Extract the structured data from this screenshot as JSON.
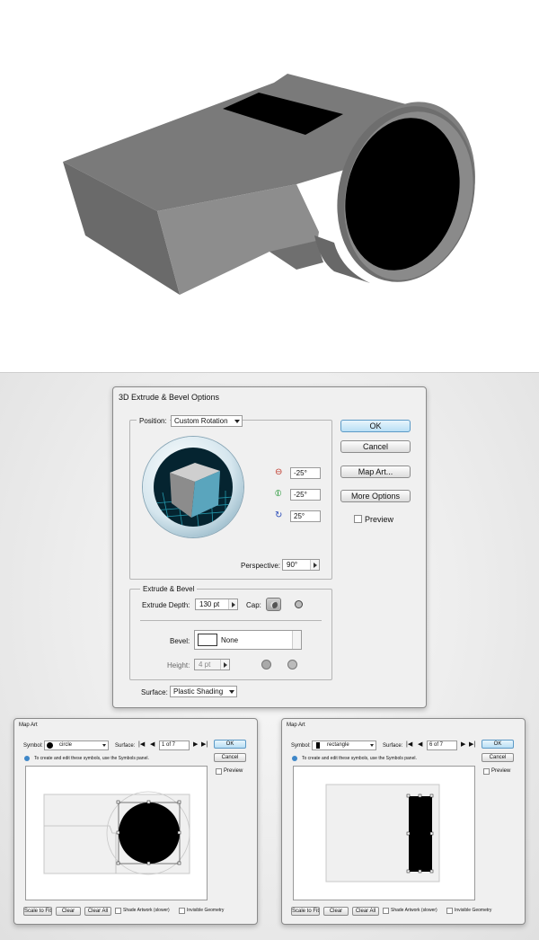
{
  "colors": {
    "whistle_dark": "#5c5c5c",
    "whistle_mid": "#7d7d7d",
    "whistle_light": "#999999",
    "cube_front": "#5aa5bd",
    "ok_accent": "#b9dff5"
  },
  "extrude_dialog": {
    "title": "3D Extrude & Bevel Options",
    "position_label": "Position:",
    "position_value": "Custom Rotation",
    "rotation_x": "-25°",
    "rotation_y": "-25°",
    "rotation_z": "25°",
    "perspective_label": "Perspective:",
    "perspective_value": "90°",
    "ok_label": "OK",
    "cancel_label": "Cancel",
    "map_art_label": "Map Art...",
    "more_options_label": "More Options",
    "preview_label": "Preview",
    "extrude_section_label": "Extrude & Bevel",
    "extrude_depth_label": "Extrude Depth:",
    "extrude_depth_value": "130 pt",
    "cap_label": "Cap:",
    "bevel_label": "Bevel:",
    "bevel_value": "None",
    "height_label": "Height:",
    "height_value": "4 pt",
    "surface_label": "Surface:",
    "surface_value": "Plastic Shading"
  },
  "map_art_left": {
    "title": "Map Art",
    "symbol_label": "Symbol:",
    "symbol_value": "circle",
    "surface_label": "Surface:",
    "surface_value": "1 of 7",
    "ok_label": "OK",
    "cancel_label": "Cancel",
    "hint": "To create and edit these symbols, use the Symbols panel.",
    "preview_label": "Preview",
    "scale_to_fit_label": "Scale to Fit",
    "clear_label": "Clear",
    "clear_all_label": "Clear All",
    "shade_artwork_label": "Shade Artwork (slower)",
    "invisible_geometry_label": "Invisible Geometry"
  },
  "map_art_right": {
    "title": "Map Art",
    "symbol_label": "Symbol:",
    "symbol_value": "rectangle",
    "surface_label": "Surface:",
    "surface_value": "6 of 7",
    "ok_label": "OK",
    "cancel_label": "Cancel",
    "hint": "To create and edit these symbols, use the Symbols panel.",
    "preview_label": "Preview",
    "scale_to_fit_label": "Scale to Fit",
    "clear_label": "Clear",
    "clear_all_label": "Clear All",
    "shade_artwork_label": "Shade Artwork (slower)",
    "invisible_geometry_label": "Invisible Geometry"
  }
}
